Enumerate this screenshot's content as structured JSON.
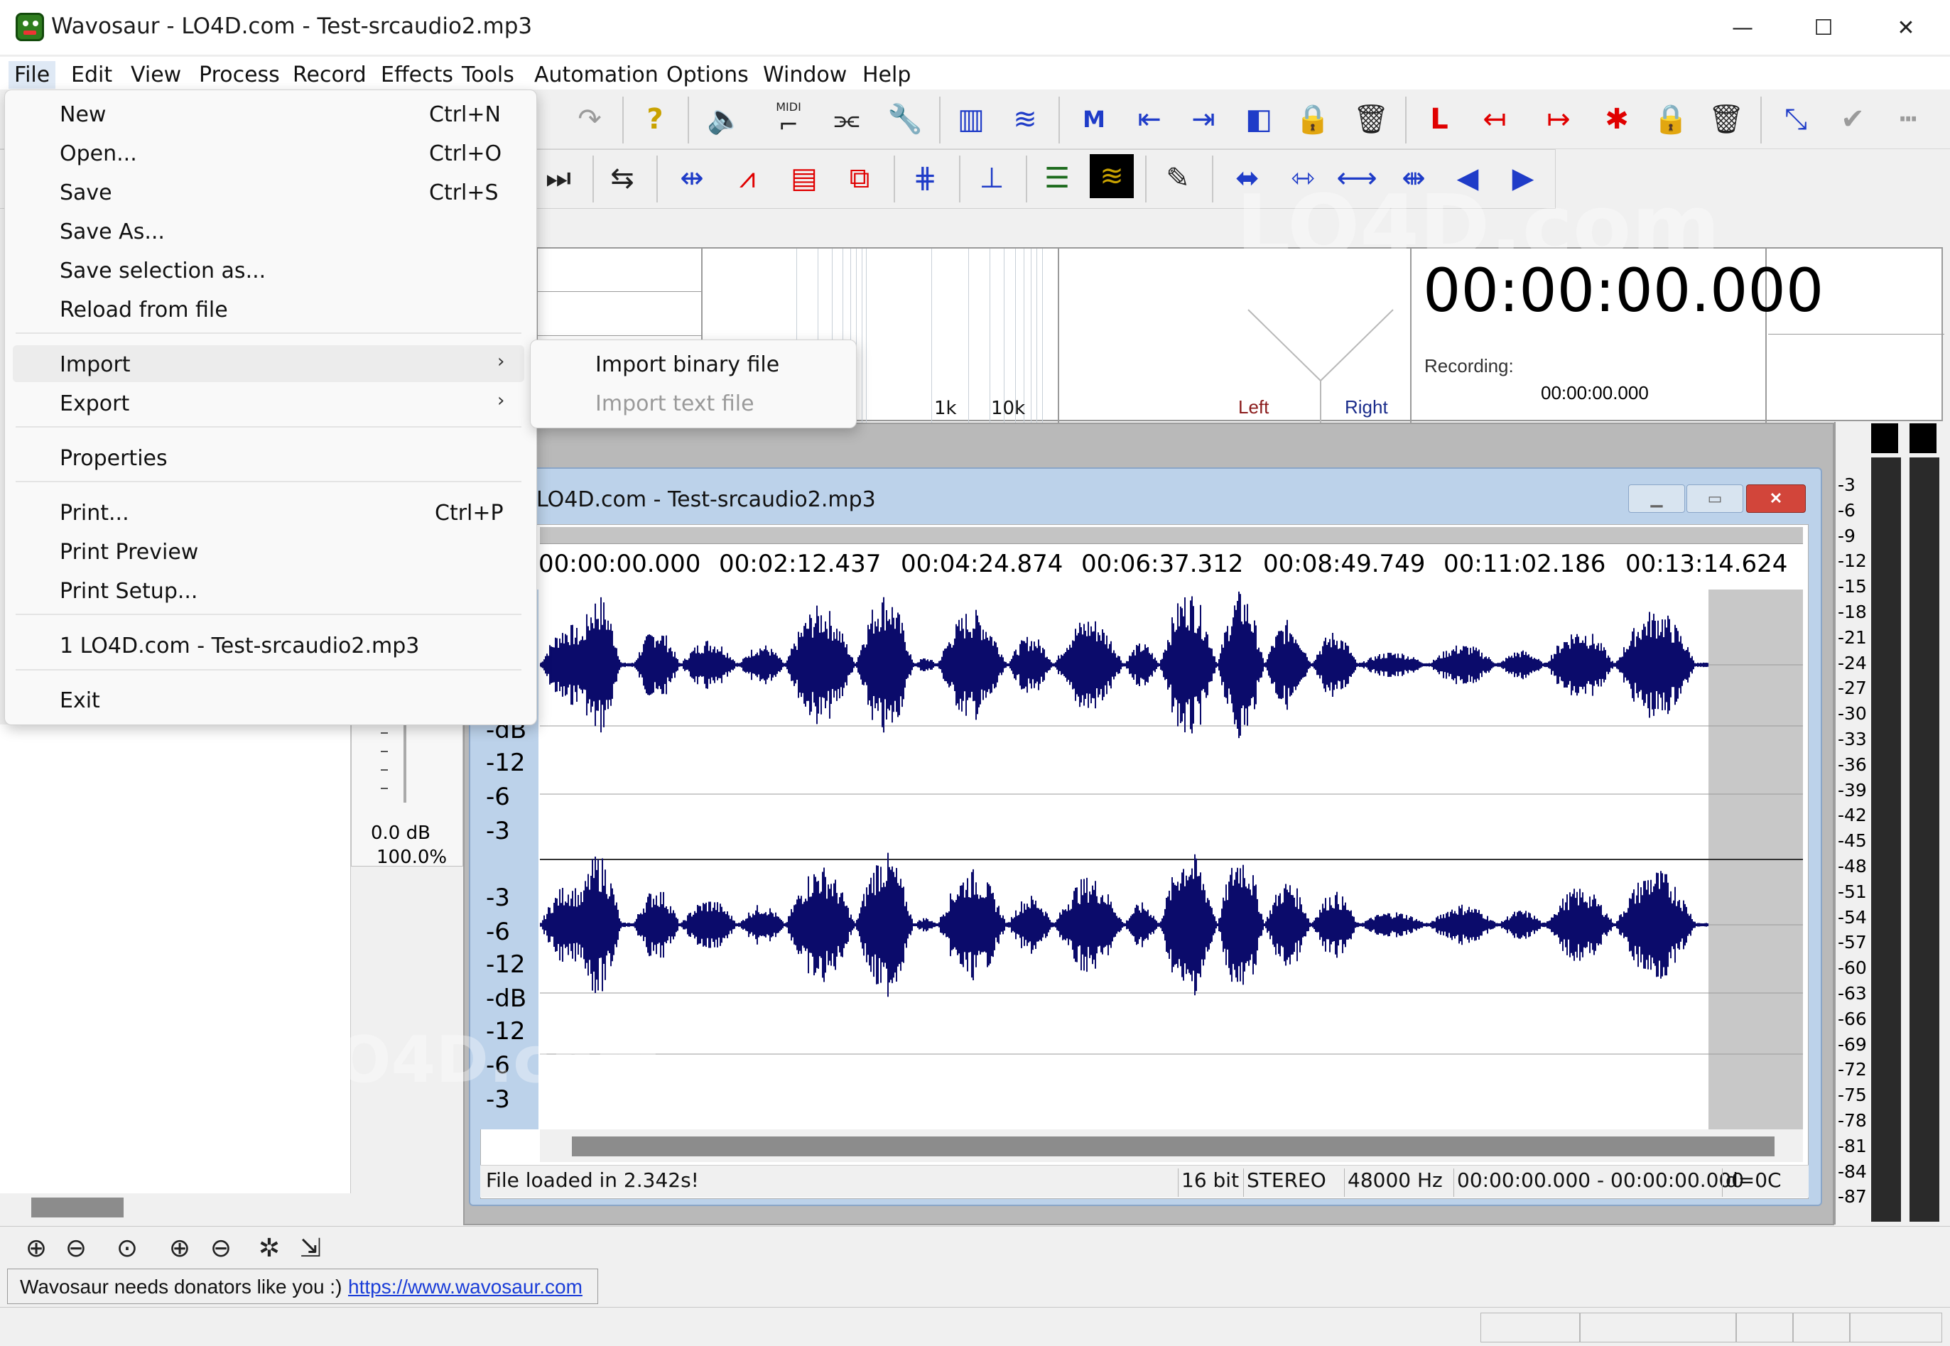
{
  "window": {
    "title": "Wavosaur - LO4D.com - Test-srcaudio2.mp3",
    "min_glyph": "—",
    "max_glyph": "☐",
    "close_glyph": "✕"
  },
  "menubar": [
    "File",
    "Edit",
    "View",
    "Process",
    "Record",
    "Effects",
    "Tools",
    "Automation",
    "Options",
    "Window",
    "Help"
  ],
  "file_menu": {
    "items": [
      {
        "label": "New",
        "shortcut": "Ctrl+N"
      },
      {
        "label": "Open...",
        "shortcut": "Ctrl+O"
      },
      {
        "label": "Save",
        "shortcut": "Ctrl+S"
      },
      {
        "label": "Save As...",
        "shortcut": ""
      },
      {
        "label": "Save selection as...",
        "shortcut": ""
      },
      {
        "label": "Reload from file",
        "shortcut": ""
      },
      {
        "label": "Import",
        "shortcut": ""
      },
      {
        "label": "Export",
        "shortcut": ""
      },
      {
        "label": "Properties",
        "shortcut": ""
      },
      {
        "label": "Print...",
        "shortcut": "Ctrl+P"
      },
      {
        "label": "Print Preview",
        "shortcut": ""
      },
      {
        "label": "Print Setup...",
        "shortcut": ""
      },
      {
        "label": "1 LO4D.com - Test-srcaudio2.mp3",
        "shortcut": ""
      },
      {
        "label": "Exit",
        "shortcut": ""
      }
    ],
    "submenu_arrow": "›"
  },
  "import_submenu": {
    "items": [
      {
        "label": "Import binary file",
        "enabled": true
      },
      {
        "label": "Import text file",
        "enabled": false
      }
    ]
  },
  "toolbar": {
    "icons_row1": [
      "redo-icon",
      "help-icon",
      "speaker-icon",
      "midi-icon",
      "wire-icon",
      "wrench-icon",
      "waveform-stereo-icon",
      "waveform-mono-icon",
      "marker-m-icon",
      "marker-left-icon",
      "marker-right-icon",
      "selection-icon",
      "lock-icon",
      "trash-icon",
      "loop-l-icon",
      "loop-left-icon",
      "loop-right-icon",
      "loop-x-icon",
      "loop-lock-icon",
      "loop-trash-icon",
      "envelope-icon",
      "check-icon",
      "dotted-line-icon"
    ],
    "icons_row2": [
      "skip-end-icon",
      "loop-toggle-icon",
      "zoom-sel-icon",
      "spectrum-icon",
      "sonogram-icon",
      "cube-icon",
      "waveform-view-icon",
      "normalize-icon",
      "vu-icon",
      "waveform-yellow-icon",
      "pencil-icon",
      "expand-icon",
      "compress-icon",
      "fit-icon",
      "stretch-icon",
      "fade-in-icon",
      "fade-out-icon"
    ],
    "midi_label": "MIDI"
  },
  "analyzer": {
    "freq_label_1k": "1k",
    "freq_label_10k": "10k",
    "left_label": "Left",
    "right_label": "Right",
    "main_time": "00:00:00.000",
    "recording_label": "Recording:",
    "recording_time": "00:00:00.000"
  },
  "document": {
    "title": "LO4D.com - Test-srcaudio2.mp3",
    "ruler_times": [
      "00:00:00.000",
      "00:02:12.437",
      "00:04:24.874",
      "00:06:37.312",
      "00:08:49.749",
      "00:11:02.186",
      "00:13:14.624"
    ],
    "db_labels_top": [
      "-dB",
      "-12",
      "-6",
      "-3"
    ],
    "db_labels_bottom": [
      "-3",
      "-6",
      "-12",
      "-dB",
      "-12",
      "-6",
      "-3"
    ],
    "status": {
      "message": "File loaded in 2.342s!",
      "bits": "16 bit",
      "channels": "STEREO",
      "rate": "48000 Hz",
      "selection": "00:00:00.000 - 00:00:00.000",
      "duration": "d=0C"
    },
    "wave_color": "#0b0b6b"
  },
  "gain": {
    "db": "0.0 dB",
    "percent": "100.0%"
  },
  "vu_labels": [
    "-3",
    "-6",
    "-9",
    "-12",
    "-15",
    "-18",
    "-21",
    "-24",
    "-27",
    "-30",
    "-33",
    "-36",
    "-39",
    "-42",
    "-45",
    "-48",
    "-51",
    "-54",
    "-57",
    "-60",
    "-63",
    "-66",
    "-69",
    "-72",
    "-75",
    "-78",
    "-81",
    "-84",
    "-87"
  ],
  "zoom_toolbar": [
    "zoom-in-icon",
    "zoom-out-icon",
    "zoom-fit-icon",
    "zoom-in-v-icon",
    "zoom-out-v-icon",
    "zoom-x2-icon",
    "zoom-reset-icon"
  ],
  "donate": {
    "text": "Wavosaur needs donators like you :)",
    "link": "https://www.wavosaur.com"
  },
  "watermark": "LO4D.com"
}
